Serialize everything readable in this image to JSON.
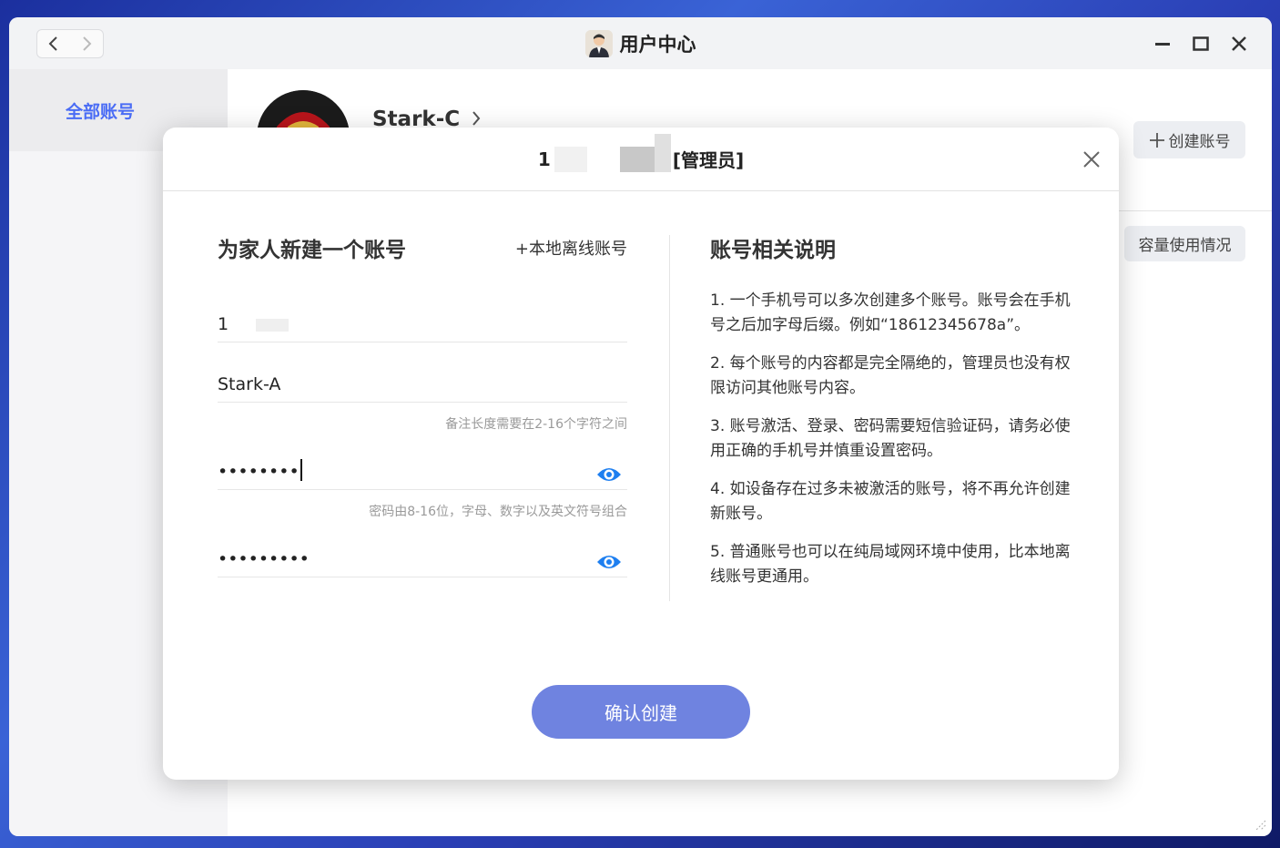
{
  "window": {
    "title": "用户中心"
  },
  "sidebar": {
    "items": [
      {
        "label": "全部账号",
        "active": true
      }
    ]
  },
  "profile": {
    "name": "Stark-C"
  },
  "toolbar": {
    "create_account_label": "创建账号",
    "usage_label": "容量使用情况"
  },
  "modal": {
    "title_prefix": "1",
    "title_suffix": "[管理员]",
    "left": {
      "heading": "为家人新建一个账号",
      "offline_link": "+本地离线账号",
      "phone_prefix": "1",
      "nickname_value": "Stark-A",
      "nickname_hint": "备注长度需要在2-16个字符之间",
      "password_value": "••••••••",
      "password_hint": "密码由8-16位，字母、数字以及英文符号组合",
      "confirm_password_value": "•••••••••"
    },
    "right": {
      "heading": "账号相关说明",
      "notes": [
        "1. 一个手机号可以多次创建多个账号。账号会在手机号之后加字母后缀。例如“18612345678a”。",
        "2. 每个账号的内容都是完全隔绝的，管理员也没有权限访问其他账号内容。",
        "3. 账号激活、登录、密码需要短信验证码，请务必使用正确的手机号并慎重设置密码。",
        "4. 如设备存在过多未被激活的账号，将不再允许创建新账号。",
        "5. 普通账号也可以在纯局域网环境中使用，比本地离线账号更通用。"
      ]
    },
    "confirm_label": "确认创建"
  },
  "colors": {
    "accent": "#4a6cf5",
    "confirm_button": "#6f83e0",
    "eye_icon": "#1e7ff0"
  }
}
